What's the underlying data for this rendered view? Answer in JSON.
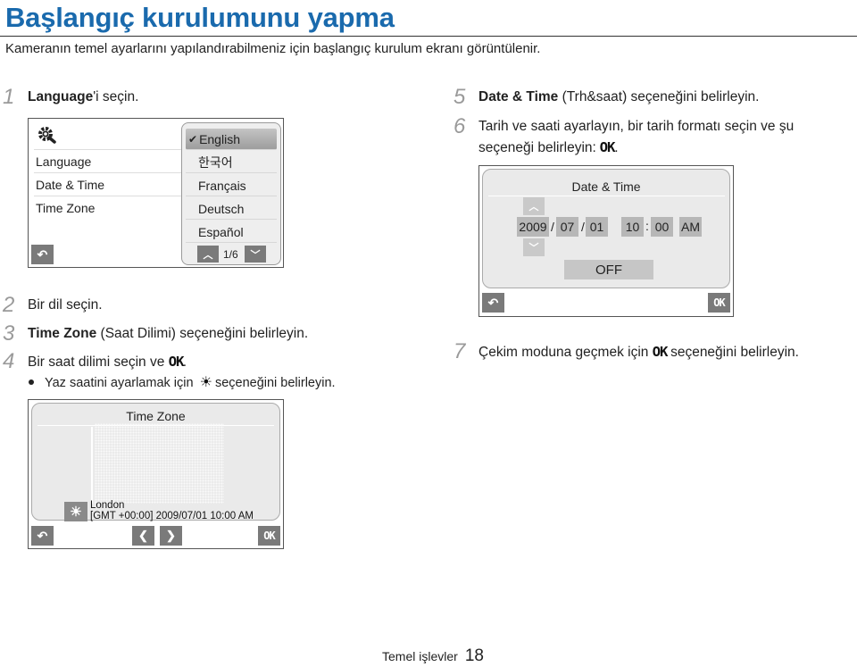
{
  "page": {
    "title": "Başlangıç kurulumunu yapma",
    "subtitle": "Kameranın temel ayarlarını yapılandırabilmeniz için başlangıç kurulum ekranı görüntülenir.",
    "footer_section": "Temel işlevler",
    "page_number": "18",
    "accent_color": "#1a6aad"
  },
  "steps": [
    {
      "num": "1",
      "bold": "Language",
      "text": "'i seçin."
    },
    {
      "num": "2",
      "bold": "",
      "text": "Bir dil seçin."
    },
    {
      "num": "3",
      "bold": "Time Zone",
      "text": " (Saat Dilimi) seçeneğini belirleyin."
    },
    {
      "num": "4",
      "bold": "",
      "text": "Bir saat dilimi seçin ve ",
      "icon": "OK",
      "after": "."
    },
    {
      "num": "5",
      "bold": "Date & Time",
      "text": " (Trh&saat) seçeneğini belirleyin."
    },
    {
      "num": "6",
      "bold": "",
      "text": "Tarih ve saati ayarlayın, bir tarih formatı seçin ve şu",
      "line2": "seçeneği belirleyin: ",
      "icon": "OK",
      "after": "."
    },
    {
      "num": "7",
      "bold": "",
      "text": "Çekim moduna geçmek için ",
      "icon": "OK",
      "after": " seçeneğini belirleyin."
    }
  ],
  "bullet": {
    "before": "Yaz saatini ayarlamak için",
    "icon": "sun-icon",
    "after": "seçeneğini belirleyin."
  },
  "screen_settings": {
    "menu": [
      "Language",
      "Date & Time",
      "Time Zone"
    ],
    "languages": [
      "English",
      "한국어",
      "Français",
      "Deutsch",
      "Español"
    ],
    "selected_language": "English",
    "page_indicator": "1/6"
  },
  "screen_datetime": {
    "title": "Date & Time",
    "year": "2009",
    "month": "07",
    "day": "01",
    "hour": "10",
    "minute": "00",
    "ampm": "AM",
    "date_sep": "/",
    "time_sep": ":",
    "dst": "OFF",
    "ok_label": "OK"
  },
  "screen_timezone": {
    "title": "Time Zone",
    "city": "London",
    "detail": "[GMT +00:00] 2009/07/01 10:00 AM",
    "ok_label": "OK"
  }
}
